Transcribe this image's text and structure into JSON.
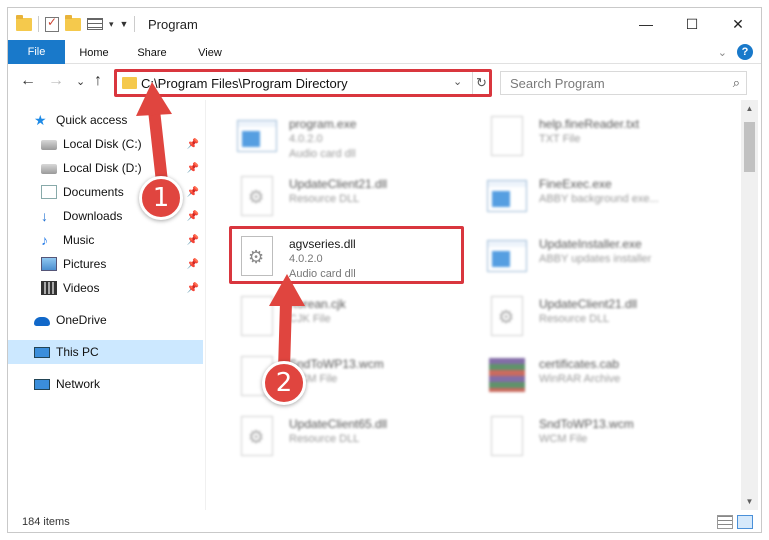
{
  "window": {
    "title": "Program",
    "controls": {
      "minimize": "—",
      "maximize": "☐",
      "close": "✕"
    },
    "quick_access_toolbar": {
      "dropdown": "▾",
      "customize": "▼"
    }
  },
  "ribbon": {
    "tabs": [
      {
        "label": "File"
      },
      {
        "label": "Home"
      },
      {
        "label": "Share"
      },
      {
        "label": "View"
      }
    ],
    "expand_glyph": "⌄",
    "help_label": "?"
  },
  "nav": {
    "back": "←",
    "forward": "→",
    "recent": "⌄",
    "up": "↑",
    "address": "C:\\Program Files\\Program Directory",
    "address_dropdown": "⌄",
    "refresh": "↻",
    "search_placeholder": "Search Program",
    "search_icon": "⌕"
  },
  "sidebar": {
    "items": [
      {
        "label": "Quick access",
        "icon": "star-icon"
      },
      {
        "label": "Local Disk (C:)",
        "icon": "disk-icon",
        "pinned": true
      },
      {
        "label": "Local Disk (D:)",
        "icon": "disk-icon",
        "pinned": true
      },
      {
        "label": "Documents",
        "icon": "documents-icon",
        "pinned": true
      },
      {
        "label": "Downloads",
        "icon": "downloads-icon",
        "pinned": true
      },
      {
        "label": "Music",
        "icon": "music-icon",
        "pinned": true
      },
      {
        "label": "Pictures",
        "icon": "pictures-icon",
        "pinned": true
      },
      {
        "label": "Videos",
        "icon": "videos-icon",
        "pinned": true
      },
      {
        "label": "OneDrive",
        "icon": "onedrive-icon"
      },
      {
        "label": "This PC",
        "icon": "pc-icon",
        "selected": true
      },
      {
        "label": "Network",
        "icon": "network-icon"
      }
    ],
    "pin_glyph": "📌"
  },
  "files": [
    {
      "name": "program.exe",
      "line2": "4.0.2.0",
      "line3": "Audio card dll",
      "icon": "program-exe-icon",
      "blurred": true
    },
    {
      "name": "help.fineReader.txt",
      "line2": "TXT File",
      "line3": "",
      "icon": "text-file-icon",
      "blurred": true
    },
    {
      "name": "UpdateClient21.dll",
      "line2": "Resource DLL",
      "line3": "",
      "icon": "dll-file-icon",
      "blurred": true
    },
    {
      "name": "FineExec.exe",
      "line2": "ABBY background exe...",
      "line3": "",
      "icon": "exe-file-icon",
      "blurred": true
    },
    {
      "name": "agvseries.dll",
      "line2": "4.0.2.0",
      "line3": "Audio card dll",
      "icon": "dll-file-icon",
      "blurred": false
    },
    {
      "name": "UpdateInstaller.exe",
      "line2": "ABBY updates installer",
      "line3": "",
      "icon": "exe-file-icon",
      "blurred": true
    },
    {
      "name": "Korean.cjk",
      "line2": "CJK File",
      "line3": "",
      "icon": "generic-file-icon",
      "blurred": true
    },
    {
      "name": "UpdateClient21.dll",
      "line2": "Resource DLL",
      "line3": "",
      "icon": "dll-file-icon",
      "blurred": true
    },
    {
      "name": "SndToWP13.wcm",
      "line2": "WCM File",
      "line3": "",
      "icon": "generic-file-icon",
      "blurred": true
    },
    {
      "name": "certificates.cab",
      "line2": "WinRAR Archive",
      "line3": "",
      "icon": "archive-file-icon",
      "blurred": true
    },
    {
      "name": "UpdateClient65.dll",
      "line2": "Resource DLL",
      "line3": "",
      "icon": "dll-file-icon",
      "blurred": true
    },
    {
      "name": "SndToWP13.wcm",
      "line2": "WCM File",
      "line3": "",
      "icon": "generic-file-icon",
      "blurred": true
    }
  ],
  "status": {
    "item_count": "184 items"
  },
  "scrollbar": {
    "up": "▲",
    "down": "▼"
  },
  "callouts": {
    "step1": "1",
    "step2": "2"
  },
  "colors": {
    "accent": "#1979ca",
    "highlight": "#d9363e",
    "callout": "#e0453f",
    "selected": "#cce8ff"
  }
}
